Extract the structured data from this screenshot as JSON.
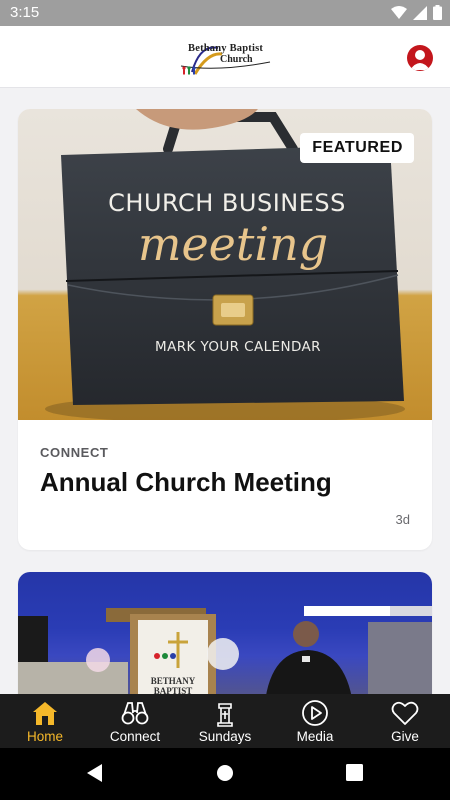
{
  "status_bar": {
    "time": "3:15"
  },
  "header": {
    "logo_line1": "Bethany Baptist",
    "logo_line2": "Church",
    "profile_icon": "user-icon"
  },
  "featured_card": {
    "badge": "FEATURED",
    "image": {
      "title": "CHURCH BUSINESS",
      "script": "meeting",
      "subtitle": "MARK YOUR CALENDAR"
    },
    "category": "CONNECT",
    "title": "Annual Church Meeting",
    "age": "3d"
  },
  "second_card": {
    "image_text": "BETHANY BAPTIST"
  },
  "tabs": [
    {
      "label": "Home",
      "icon": "home-icon",
      "active": true
    },
    {
      "label": "Connect",
      "icon": "binoculars-icon",
      "active": false
    },
    {
      "label": "Sundays",
      "icon": "podium-icon",
      "active": false
    },
    {
      "label": "Media",
      "icon": "play-circle-icon",
      "active": false
    },
    {
      "label": "Give",
      "icon": "heart-icon",
      "active": false
    }
  ],
  "colors": {
    "accent": "#f5b82a",
    "tab_bar": "#1c1c1c",
    "profile": "#c3161c",
    "status_bar": "#9e9e9e"
  }
}
